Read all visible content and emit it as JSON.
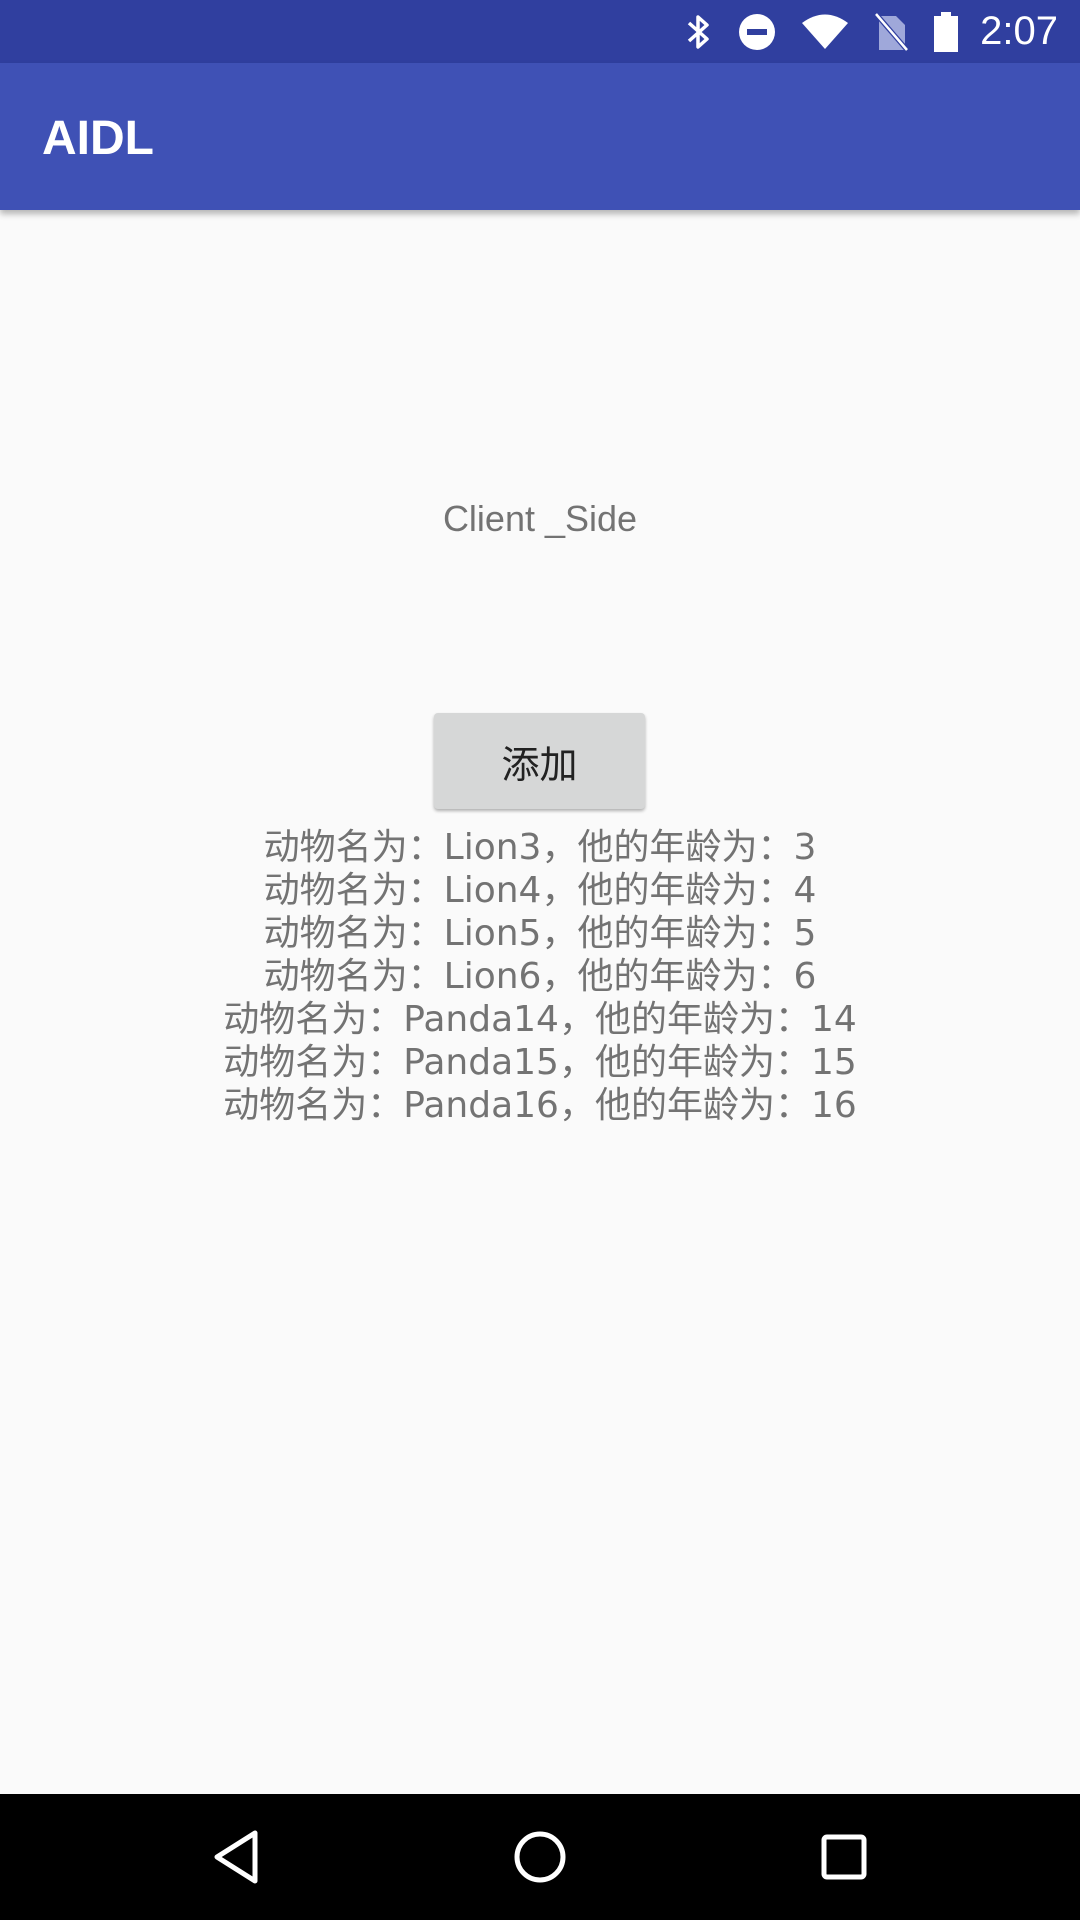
{
  "status_bar": {
    "time": "2:07",
    "icons": [
      "bluetooth-icon",
      "do-not-disturb-icon",
      "wifi-icon",
      "no-sim-icon",
      "battery-icon"
    ],
    "background_color": "#303f9f"
  },
  "app_bar": {
    "title": "AIDL",
    "background_color": "#3f51b5"
  },
  "main": {
    "label": "Client _Side",
    "add_button_label": "添加",
    "results": [
      "动物名为：Lion3，他的年龄为：3",
      "动物名为：Lion4，他的年龄为：4",
      "动物名为：Lion5，他的年龄为：5",
      "动物名为：Lion6，他的年龄为：6",
      "动物名为：Panda14，他的年龄为：14",
      "动物名为：Panda15，他的年龄为：15",
      "动物名为：Panda16，他的年龄为：16"
    ]
  },
  "nav_bar": {
    "buttons": [
      "back-icon",
      "home-icon",
      "recents-icon"
    ]
  }
}
